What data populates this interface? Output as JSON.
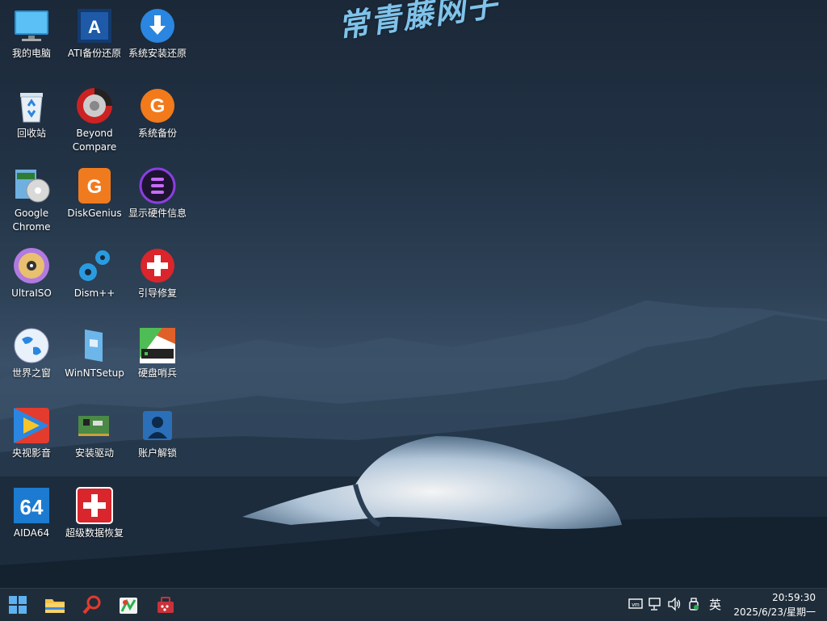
{
  "watermark": "常青藤网子",
  "desktop_icons": [
    {
      "label": "我的电脑",
      "icon": "monitor-icon"
    },
    {
      "label": "ATI备份还原",
      "icon": "acronis-icon"
    },
    {
      "label": "系统安装还原",
      "icon": "download-arrow-icon"
    },
    {
      "label": "回收站",
      "icon": "recycle-bin-icon"
    },
    {
      "label": "Beyond Compare",
      "icon": "beyond-compare-icon"
    },
    {
      "label": "系统备份",
      "icon": "g-backup-icon"
    },
    {
      "label": "Google Chrome",
      "icon": "setup-cd-icon"
    },
    {
      "label": "DiskGenius",
      "icon": "diskgenius-icon"
    },
    {
      "label": "显示硬件信息",
      "icon": "hardware-info-icon"
    },
    {
      "label": "UltraISO",
      "icon": "disc-icon"
    },
    {
      "label": "Dism++",
      "icon": "gears-icon"
    },
    {
      "label": "引导修复",
      "icon": "red-cross-icon"
    },
    {
      "label": "世界之窗",
      "icon": "globe-icon"
    },
    {
      "label": "WinNTSetup",
      "icon": "winntsetup-icon"
    },
    {
      "label": "硬盘哨兵",
      "icon": "hard-disk-sentinel-icon"
    },
    {
      "label": "央视影音",
      "icon": "media-player-icon"
    },
    {
      "label": "安装驱动",
      "icon": "circuit-board-icon"
    },
    {
      "label": "账户解锁",
      "icon": "user-accounts-icon"
    },
    {
      "label": "AIDA64",
      "icon": "aida64-icon"
    },
    {
      "label": "超级数据恢复",
      "icon": "data-recovery-icon"
    }
  ],
  "taskbar": {
    "pinned": [
      "start-icon",
      "file-explorer-icon",
      "search-magnifier-icon",
      "app-icon",
      "toolbox-icon"
    ],
    "tray_icons": [
      "vm-icon",
      "network-icon",
      "volume-icon",
      "usb-icon"
    ],
    "ime": "英",
    "time": "20:59:30",
    "date": "2025/6/23/星期一"
  }
}
